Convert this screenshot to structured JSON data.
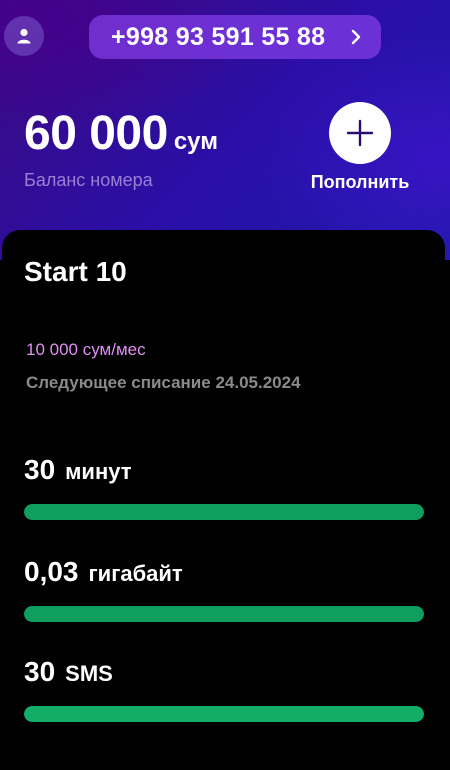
{
  "header": {
    "phone_number": "+998 93 591 55 88",
    "balance_amount": "60 000",
    "balance_currency": "сум",
    "balance_label": "Баланс номера",
    "topup_label": "Пополнить",
    "icons": {
      "avatar": "user-icon",
      "chevron": "chevron-right-icon",
      "topup": "plus-icon"
    }
  },
  "plan": {
    "name": "Start 10",
    "price": "10 000 сум/мес",
    "next_charge": "Следующее списание 24.05.2024"
  },
  "quotas": [
    {
      "value": "30",
      "unit": "минут",
      "remaining_fraction": 1.0
    },
    {
      "value": "0,03",
      "unit": "гигабайт",
      "remaining_fraction": 1.0
    },
    {
      "value": "30",
      "unit": "SMS",
      "remaining_fraction": 1.0
    }
  ],
  "colors": {
    "accent_purple": "#823ce6",
    "price_pink": "#e08ff0",
    "progress_green": "#0f9e5e"
  }
}
